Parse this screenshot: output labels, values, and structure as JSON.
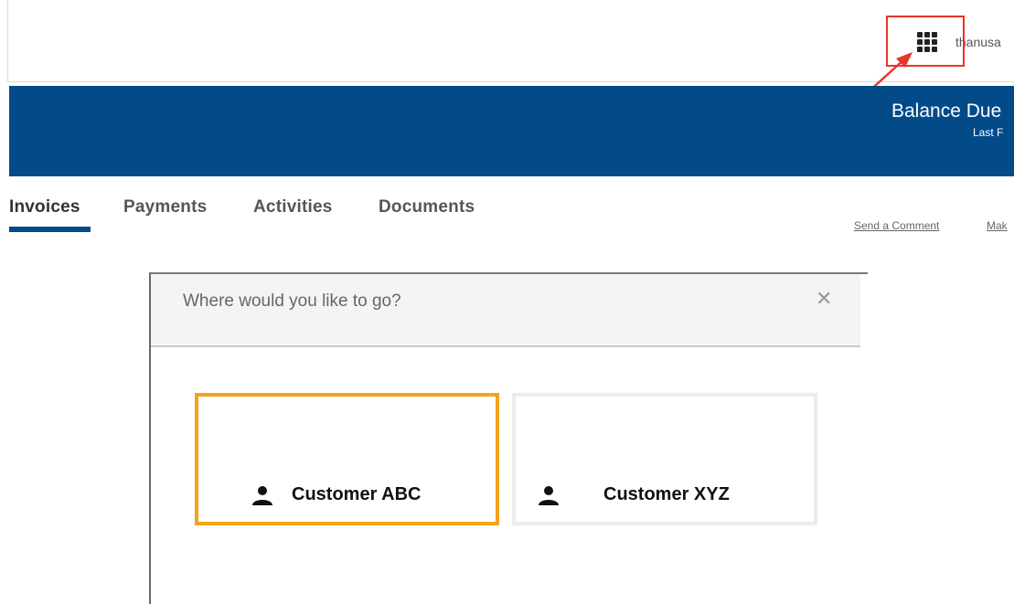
{
  "header": {
    "apps_icon": "grid-apps-icon",
    "user_name": "thanusa"
  },
  "banner": {
    "balance_label": "Balance Due",
    "last_label": "Last F"
  },
  "tabs": [
    {
      "label": "Invoices",
      "active": true
    },
    {
      "label": "Payments",
      "active": false
    },
    {
      "label": "Activities",
      "active": false
    },
    {
      "label": "Documents",
      "active": false
    }
  ],
  "actions": {
    "send_comment": "Send a Comment",
    "make": "Mak"
  },
  "modal": {
    "title": "Where would you like to go?",
    "close_label": "✕",
    "customers": [
      {
        "name": "Customer ABC",
        "icon": "person-icon",
        "selected": true
      },
      {
        "name": "Customer XYZ",
        "icon": "person-icon",
        "selected": false
      }
    ]
  },
  "colors": {
    "banner": "#034a89",
    "selected_border": "#f5a31e",
    "highlight": "#e8352b"
  }
}
